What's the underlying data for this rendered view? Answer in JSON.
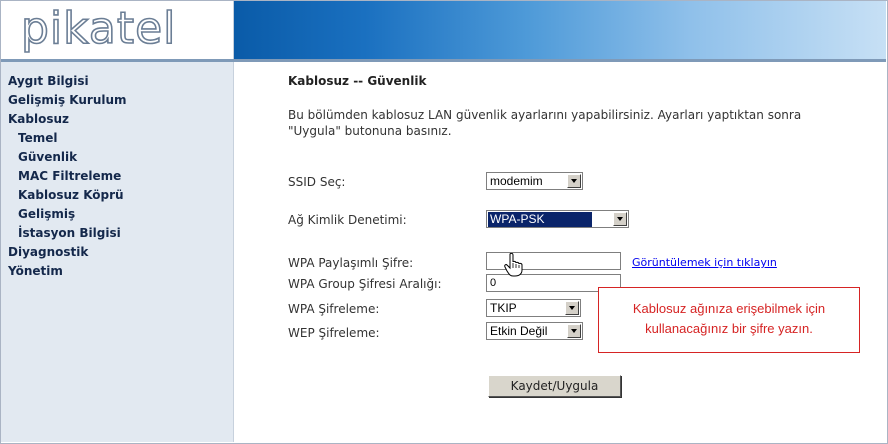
{
  "brand": {
    "logo_text": "pikatel"
  },
  "sidebar": {
    "items": [
      {
        "label": "Aygıt Bilgisi"
      },
      {
        "label": "Gelişmiş Kurulum"
      },
      {
        "label": "Kablosuz"
      },
      {
        "label": "Temel"
      },
      {
        "label": "Güvenlik"
      },
      {
        "label": "MAC Filtreleme"
      },
      {
        "label": "Kablosuz Köprü"
      },
      {
        "label": "Gelişmiş"
      },
      {
        "label": "İstasyon Bilgisi"
      },
      {
        "label": "Diyagnostik"
      },
      {
        "label": "Yönetim"
      }
    ]
  },
  "main": {
    "title": "Kablosuz -- Güvenlik",
    "description_line1": "Bu bölümden kablosuz LAN güvenlik ayarlarını yapabilirsiniz. Ayarları yaptıktan sonra",
    "description_line2": "\"Uygula\" butonuna basınız.",
    "fields": {
      "ssid": {
        "label": "SSID Seç:",
        "value": "modemim"
      },
      "auth": {
        "label": "Ağ Kimlik Denetimi:",
        "value": "WPA-PSK"
      },
      "wpa_key": {
        "label": "WPA Paylaşımlı Şifre:",
        "value": "",
        "show_link": "Görüntülemek için tıklayın"
      },
      "group_interval": {
        "label": "WPA Group Şifresi Aralığı:",
        "value": "0"
      },
      "wpa_encryption": {
        "label": "WPA Şifreleme:",
        "value": "TKIP"
      },
      "wep_encryption": {
        "label": "WEP Şifreleme:",
        "value": "Etkin Değil"
      }
    },
    "save_label": "Kaydet/Uygula"
  },
  "tooltip": {
    "line1": "Kablosuz ağınıza erişebilmek için",
    "line2": "kullanacağınız bir şifre yazın."
  },
  "colors": {
    "tooltip_border": "#d62424",
    "sidebar_bg": "#e2e9f1",
    "banner_start": "#0a5ba8",
    "banner_end": "#c7e0f5"
  },
  "icons": {
    "cursor": "hand-pointer-icon"
  }
}
